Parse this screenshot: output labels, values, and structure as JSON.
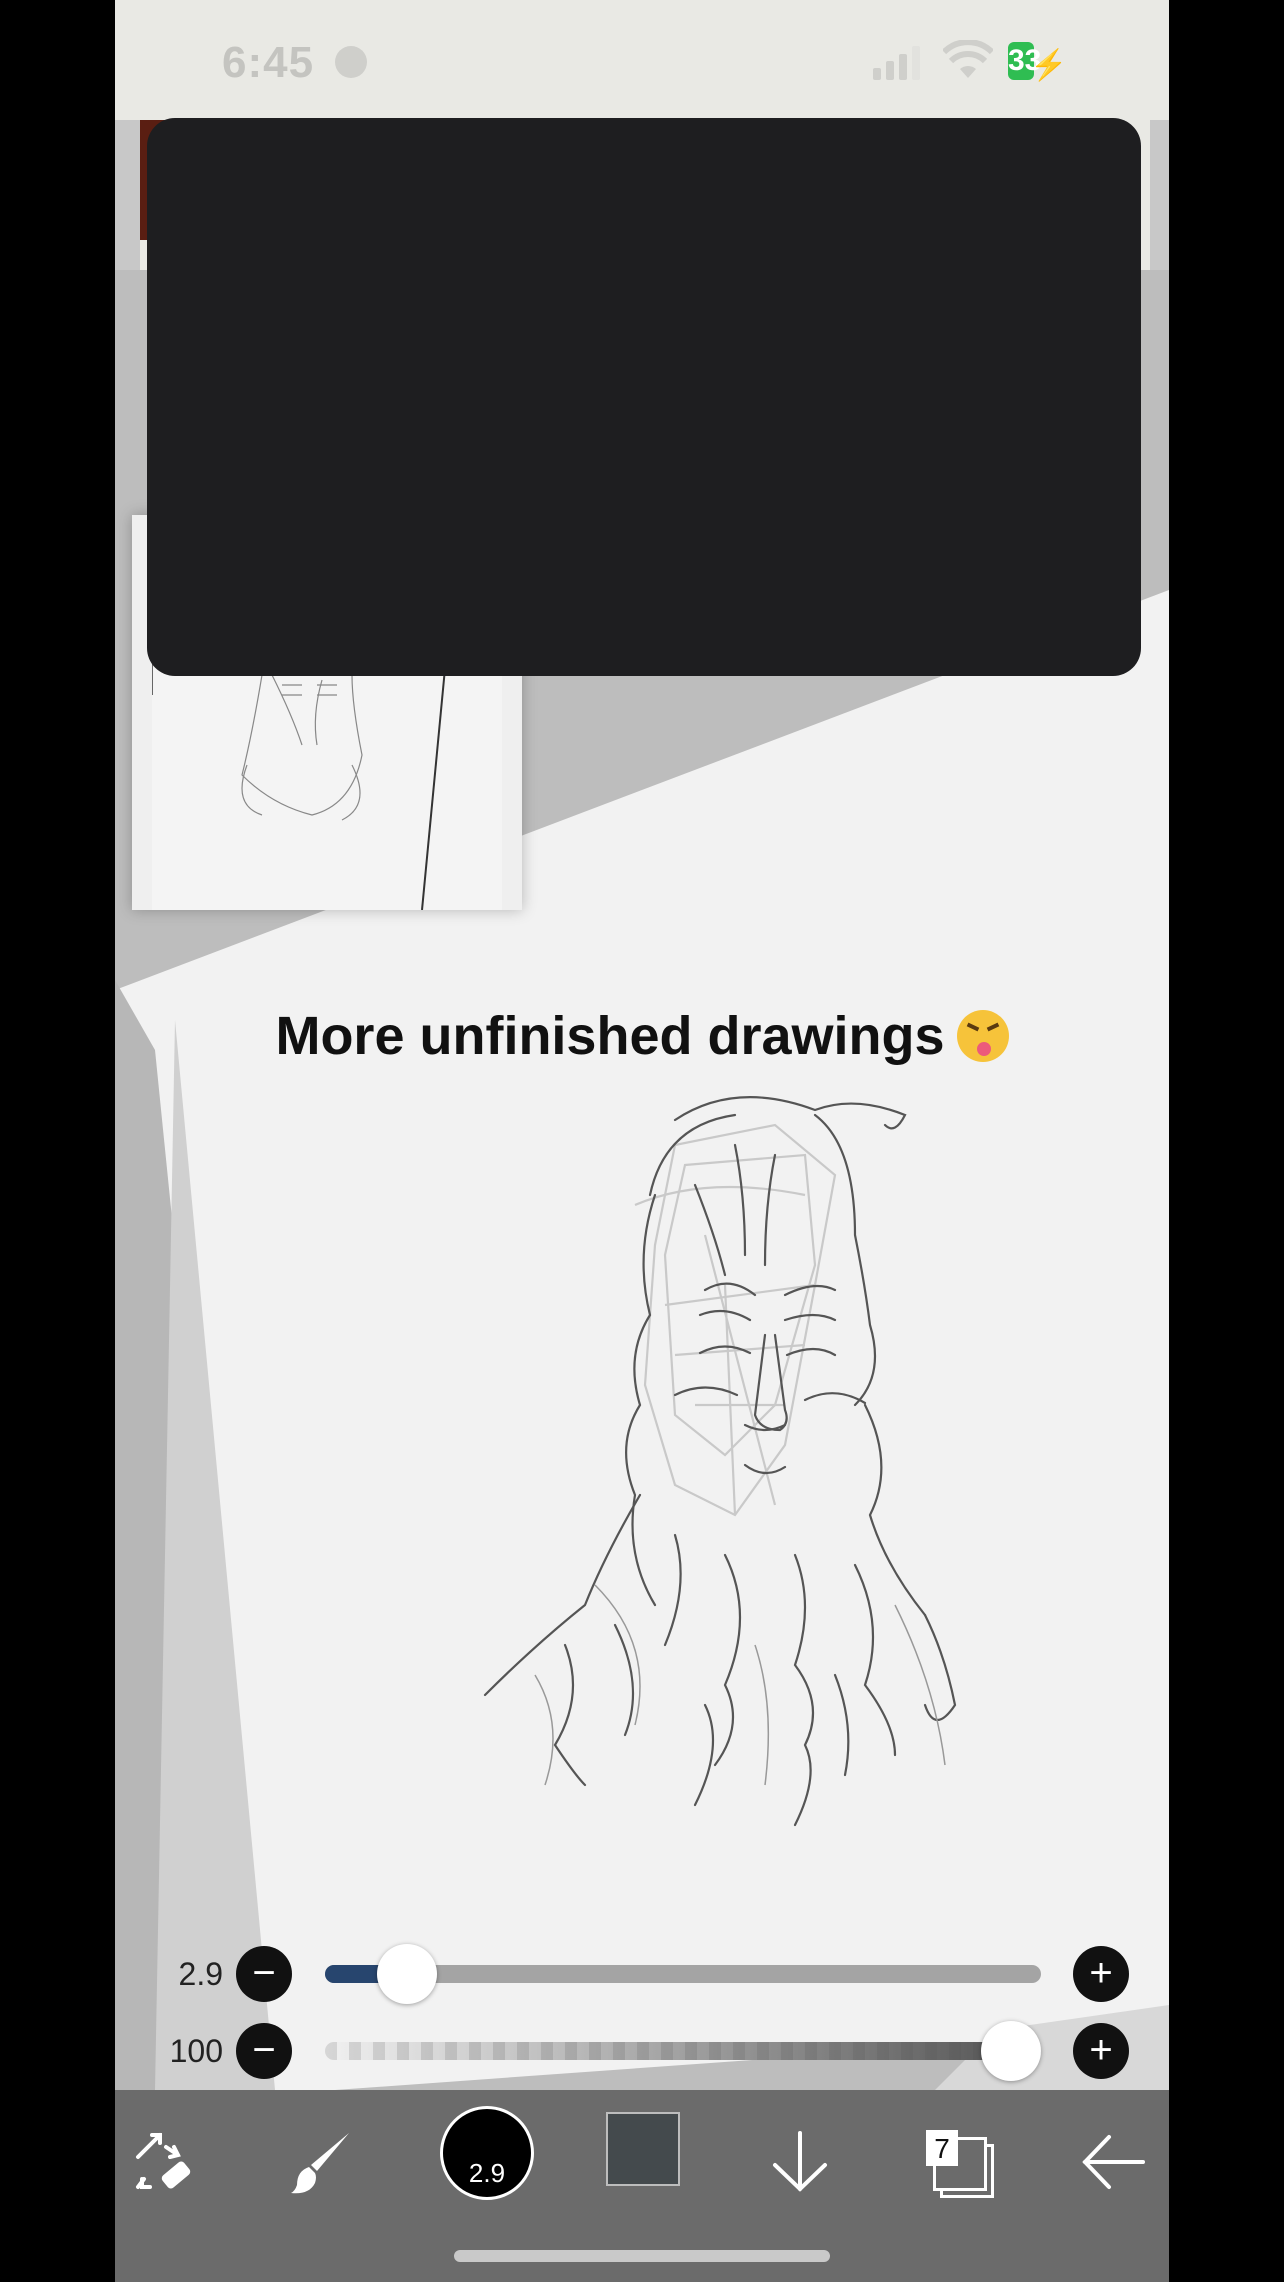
{
  "status_bar": {
    "time": "6:45",
    "battery": "33"
  },
  "canvas": {
    "title": "More unfinished drawings"
  },
  "brush_size_slider": {
    "value": "2.9",
    "fraction": 0.08
  },
  "opacity_slider": {
    "value": "100",
    "fraction": 1.0
  },
  "toolbar": {
    "tools": [
      "transform-icon",
      "brush-icon",
      "brush-size",
      "color",
      "download-icon",
      "layers-icon",
      "back-arrow-icon"
    ],
    "brush_size_label": "2.9",
    "color": "#444a4d",
    "layers_count": "7"
  },
  "colors": {
    "size_fill": "#27456e",
    "toolbar_bg": "#6b6b6b",
    "battery_green": "#2fbd52"
  }
}
